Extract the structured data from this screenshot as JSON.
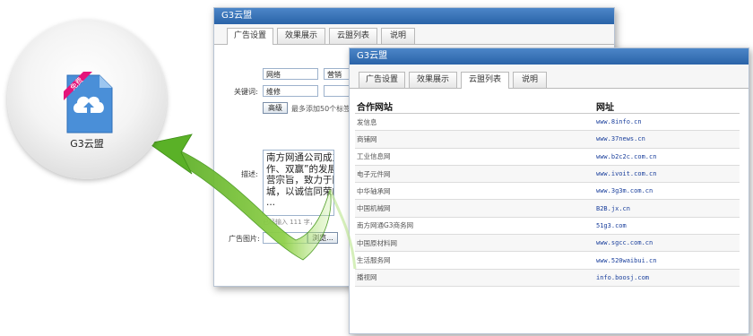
{
  "app": {
    "name": "G3云盟",
    "badge": "免费",
    "icon": "cloud-upload-icon"
  },
  "back_window": {
    "title": "G3云盟",
    "tabs": [
      "广告设置",
      "效果展示",
      "云盟列表",
      "说明"
    ],
    "active_tab": 0,
    "form": {
      "keyword_label": "关键词:",
      "keywords": [
        "网络",
        "营销",
        "维修",
        ""
      ],
      "advanced_button": "高级",
      "tag_hint": "最多添加50个标签",
      "desc_label": "描述:",
      "description": "南方网通公司成立于20\n作、双赢”的发展理念\n营宗旨，致力于网络营\n城，以诚信同荣的饱满\n...",
      "char_hint": "已经输入 111 字，",
      "image_label": "广告图片:",
      "browse_button": "浏览..."
    }
  },
  "front_window": {
    "title": "G3云盟",
    "tabs": [
      "广告设置",
      "效果展示",
      "云盟列表",
      "说明"
    ],
    "active_tab": 2,
    "table": {
      "headers": [
        "合作网站",
        "网址"
      ],
      "rows": [
        {
          "name": "发信息",
          "url": "www.8info.cn"
        },
        {
          "name": "商铺网",
          "url": "www.37news.cn"
        },
        {
          "name": "工业信息网",
          "url": "www.b2c2c.com.cn"
        },
        {
          "name": "电子元件网",
          "url": "www.ivoit.com.cn"
        },
        {
          "name": "中华轴承网",
          "url": "www.3g3m.com.cn"
        },
        {
          "name": "中国机械网",
          "url": "B2B.jx.cn"
        },
        {
          "name": "南方网通G3商务网",
          "url": "51g3.com"
        },
        {
          "name": "中国原材料网",
          "url": "www.sgcc.com.cn"
        },
        {
          "name": "生活服务网",
          "url": "www.520waibui.cn"
        },
        {
          "name": "播视网",
          "url": "info.boosj.com"
        }
      ]
    }
  },
  "colors": {
    "titlebar": "#2a63a8",
    "arrow": "#66b82a",
    "badge": "#e4147a",
    "icon_blue": "#4a8fd8"
  }
}
